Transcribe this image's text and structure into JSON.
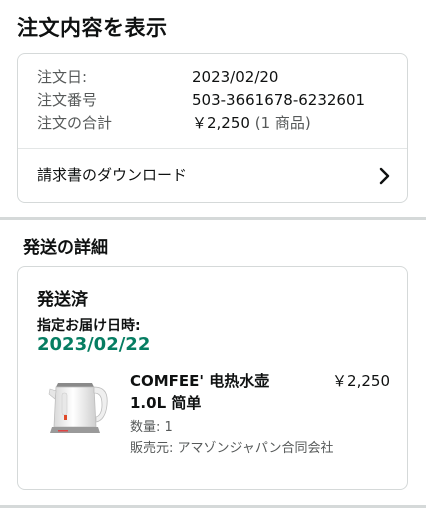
{
  "page": {
    "title": "注文内容を表示"
  },
  "order_summary": {
    "rows": [
      {
        "label": "注文日:",
        "value": "2023/02/20"
      },
      {
        "label": "注文番号",
        "value": "503-3661678-6232601"
      },
      {
        "label": "注文の合計",
        "value": "￥2,250",
        "suffix": "(1 商品)"
      }
    ],
    "invoice_label": "請求書のダウンロード",
    "invoice_icon": "chevron-right-icon"
  },
  "shipping": {
    "section_title": "発送の詳細",
    "status": "発送済",
    "delivery_label": "指定お届け日時:",
    "delivery_date": "2023/02/22",
    "delivery_date_color": "#067d62",
    "item": {
      "name": "COMFEE' 电热水壶 1.0L 简单",
      "price": "￥2,250",
      "quantity": "数量: 1",
      "seller": "販売元: アマゾンジャパン合同会社",
      "image_icon": "electric-kettle-icon"
    }
  }
}
